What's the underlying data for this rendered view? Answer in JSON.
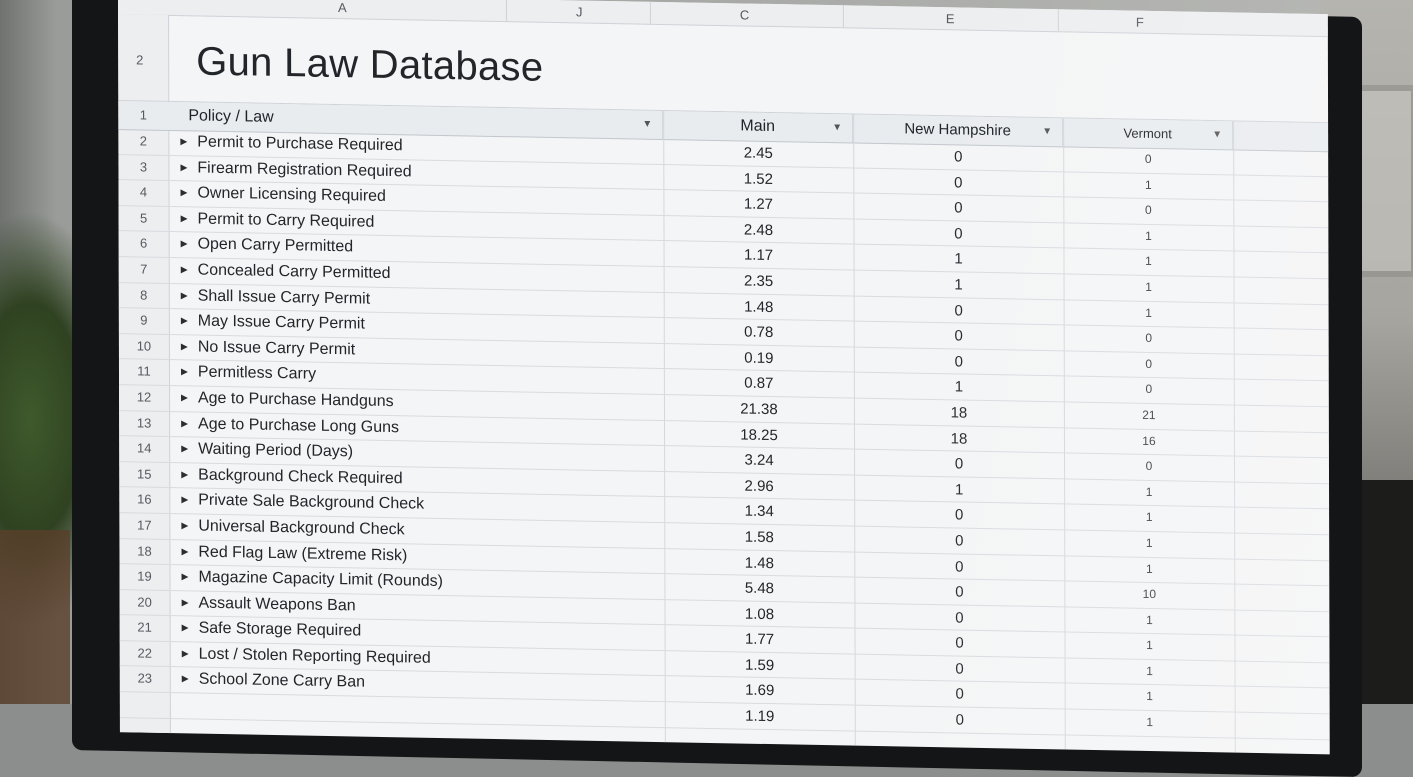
{
  "sheet": {
    "column_letters": [
      "A",
      "J",
      "C",
      "E",
      "F"
    ],
    "title_row_number": "2",
    "title": "Gun Law Database",
    "header_row_number": "1",
    "headers": {
      "policy": "Policy / Law",
      "col1": "Main",
      "col2": "New Hampshire",
      "col3": "Vermont"
    },
    "rows": [
      {
        "n": "2",
        "law": "Permit to Purchase Required",
        "main": "2.45",
        "nh": "0",
        "vt": "0"
      },
      {
        "n": "3",
        "law": "Firearm Registration Required",
        "main": "1.52",
        "nh": "0",
        "vt": "1"
      },
      {
        "n": "4",
        "law": "Owner Licensing Required",
        "main": "1.27",
        "nh": "0",
        "vt": "0"
      },
      {
        "n": "5",
        "law": "Permit to Carry Required",
        "main": "2.48",
        "nh": "0",
        "vt": "1"
      },
      {
        "n": "6",
        "law": "Open Carry Permitted",
        "main": "1.17",
        "nh": "1",
        "vt": "1"
      },
      {
        "n": "7",
        "law": "Concealed Carry Permitted",
        "main": "2.35",
        "nh": "1",
        "vt": "1"
      },
      {
        "n": "8",
        "law": "Shall Issue Carry Permit",
        "main": "1.48",
        "nh": "0",
        "vt": "1"
      },
      {
        "n": "9",
        "law": "May Issue Carry Permit",
        "main": "0.78",
        "nh": "0",
        "vt": "0"
      },
      {
        "n": "10",
        "law": "No Issue Carry Permit",
        "main": "0.19",
        "nh": "0",
        "vt": "0"
      },
      {
        "n": "11",
        "law": "Permitless Carry",
        "main": "0.87",
        "nh": "1",
        "vt": "0"
      },
      {
        "n": "12",
        "law": "Age to Purchase Handguns",
        "main": "21.38",
        "nh": "18",
        "vt": "21"
      },
      {
        "n": "13",
        "law": "Age to Purchase Long Guns",
        "main": "18.25",
        "nh": "18",
        "vt": "16"
      },
      {
        "n": "14",
        "law": "Waiting Period (Days)",
        "main": "3.24",
        "nh": "0",
        "vt": "0"
      },
      {
        "n": "15",
        "law": "Background Check Required",
        "main": "2.96",
        "nh": "1",
        "vt": "1"
      },
      {
        "n": "16",
        "law": "Private Sale Background Check",
        "main": "1.34",
        "nh": "0",
        "vt": "1"
      },
      {
        "n": "17",
        "law": "Universal Background Check",
        "main": "1.58",
        "nh": "0",
        "vt": "1"
      },
      {
        "n": "18",
        "law": "Red Flag Law (Extreme Risk)",
        "main": "1.48",
        "nh": "0",
        "vt": "1"
      },
      {
        "n": "19",
        "law": "Magazine Capacity Limit (Rounds)",
        "main": "5.48",
        "nh": "0",
        "vt": "10"
      },
      {
        "n": "20",
        "law": "Assault Weapons Ban",
        "main": "1.08",
        "nh": "0",
        "vt": "1"
      },
      {
        "n": "21",
        "law": "Safe Storage Required",
        "main": "1.77",
        "nh": "0",
        "vt": "1"
      },
      {
        "n": "22",
        "law": "Lost / Stolen Reporting Required",
        "main": "1.59",
        "nh": "0",
        "vt": "1"
      },
      {
        "n": "23",
        "law": "School Zone Carry Ban",
        "main": "1.69",
        "nh": "0",
        "vt": "1"
      }
    ],
    "extra_values": {
      "main": "1.19",
      "nh": "0",
      "vt": "1"
    },
    "icons": {
      "filter": "dropdown-filter-icon",
      "expand": "expand-triangle-icon"
    }
  }
}
